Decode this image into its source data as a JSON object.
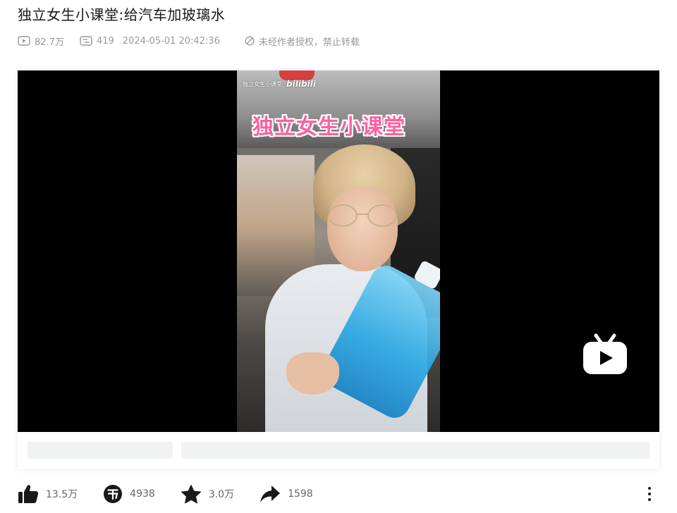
{
  "video": {
    "title": "独立女生小课堂:给汽车加玻璃水",
    "views": "82.7万",
    "danmaku": "419",
    "date": "2024-05-01 20:42:36",
    "copyright": "未经作者授权，禁止转载"
  },
  "player": {
    "frame_channel_text": "独立女生小课堂",
    "frame_logo": "bilibili",
    "frame_banner": "独立女生小课堂"
  },
  "actions": {
    "like": "13.5万",
    "coin": "4938",
    "favorite": "3.0万",
    "share": "1598"
  },
  "colors": {
    "text_primary": "#18191c",
    "text_secondary": "#9499a0",
    "action_text": "#61666d",
    "placeholder": "#f1f2f3",
    "banner_pink": "#ff5fa2"
  },
  "icons": {
    "views": "play-count-icon",
    "danmaku": "danmaku-icon",
    "like": "thumbs-up-icon",
    "coin": "coin-icon",
    "favorite": "star-icon",
    "share": "share-arrow-icon",
    "more": "more-vertical-icon",
    "watermark": "bilibili-tv-icon"
  }
}
